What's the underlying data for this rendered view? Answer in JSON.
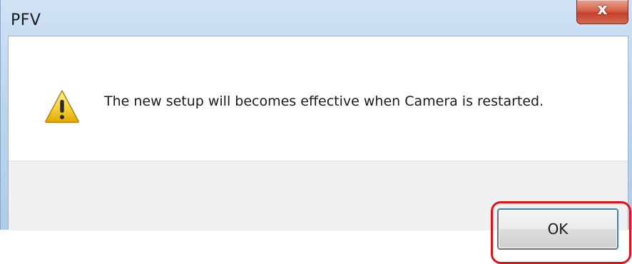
{
  "window": {
    "title": "PFV",
    "close_glyph": "x"
  },
  "dialog": {
    "icon": "warning-icon",
    "message": "The new setup will becomes effective when Camera is restarted."
  },
  "buttons": {
    "ok_label": "OK"
  },
  "colors": {
    "highlight": "#d9141b",
    "close_button": "#c4402a",
    "warning_yellow": "#f2c200"
  }
}
